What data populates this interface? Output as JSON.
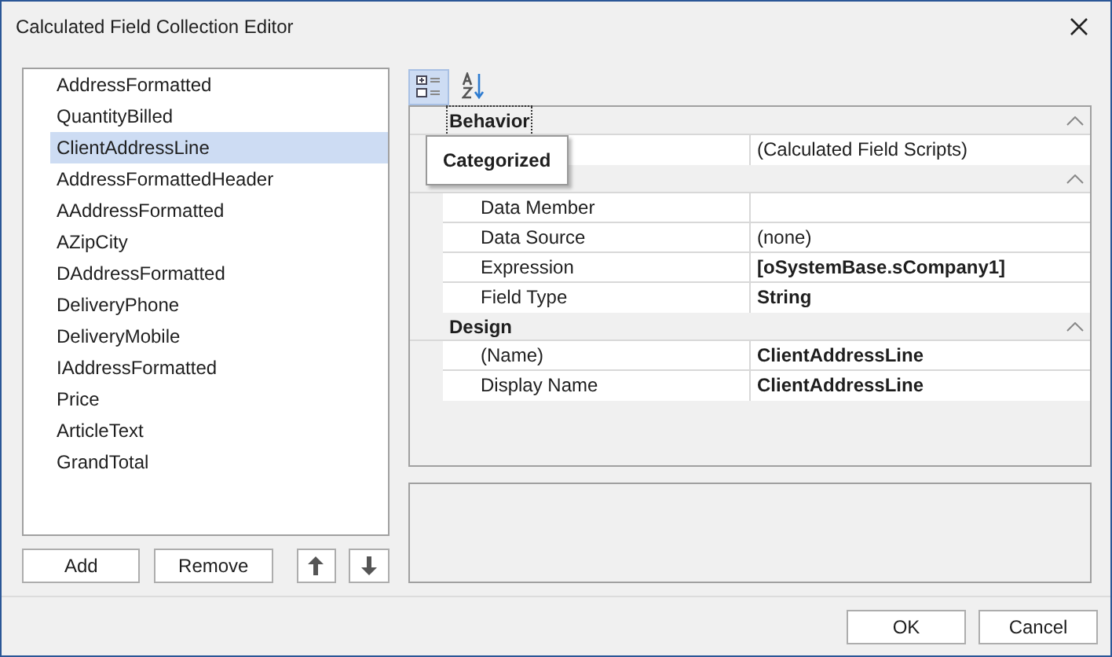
{
  "window": {
    "title": "Calculated Field Collection Editor"
  },
  "fields": [
    {
      "label": "AddressFormatted",
      "selected": false
    },
    {
      "label": "QuantityBilled",
      "selected": false
    },
    {
      "label": "ClientAddressLine",
      "selected": true
    },
    {
      "label": "AddressFormattedHeader",
      "selected": false
    },
    {
      "label": "AAddressFormatted",
      "selected": false
    },
    {
      "label": "AZipCity",
      "selected": false
    },
    {
      "label": "DAddressFormatted",
      "selected": false
    },
    {
      "label": "DeliveryPhone",
      "selected": false
    },
    {
      "label": "DeliveryMobile",
      "selected": false
    },
    {
      "label": "IAddressFormatted",
      "selected": false
    },
    {
      "label": "Price",
      "selected": false
    },
    {
      "label": "ArticleText",
      "selected": false
    },
    {
      "label": "GrandTotal",
      "selected": false
    }
  ],
  "list_buttons": [
    {
      "kind": "text",
      "label": "Add"
    },
    {
      "kind": "text",
      "label": "Remove"
    },
    {
      "kind": "up"
    },
    {
      "kind": "down"
    }
  ],
  "toolbar": [
    {
      "kind": "categorized",
      "selected": true
    },
    {
      "kind": "alphabetical",
      "selected": false
    }
  ],
  "tooltip": "Categorized",
  "property_grid": [
    {
      "category": "Behavior",
      "focused": true,
      "expanded": true,
      "rows": [
        {
          "value": "(Calculated Field Scripts)"
        }
      ]
    },
    {
      "expanded": true,
      "rows": [
        {
          "name": "Data Member"
        },
        {
          "name": "Data Source",
          "value": "(none)"
        },
        {
          "name": "Expression",
          "value": "[oSystemBase.sCompany1]",
          "bold": true
        },
        {
          "name": "Field Type",
          "value": "String",
          "bold": true
        }
      ]
    },
    {
      "category": "Design",
      "focused": false,
      "expanded": true,
      "rows": [
        {
          "name": "(Name)",
          "value": "ClientAddressLine",
          "bold": true
        },
        {
          "name": "Display Name",
          "value": "ClientAddressLine",
          "bold": true
        }
      ]
    }
  ],
  "dialog_buttons": [
    "OK",
    "Cancel"
  ]
}
